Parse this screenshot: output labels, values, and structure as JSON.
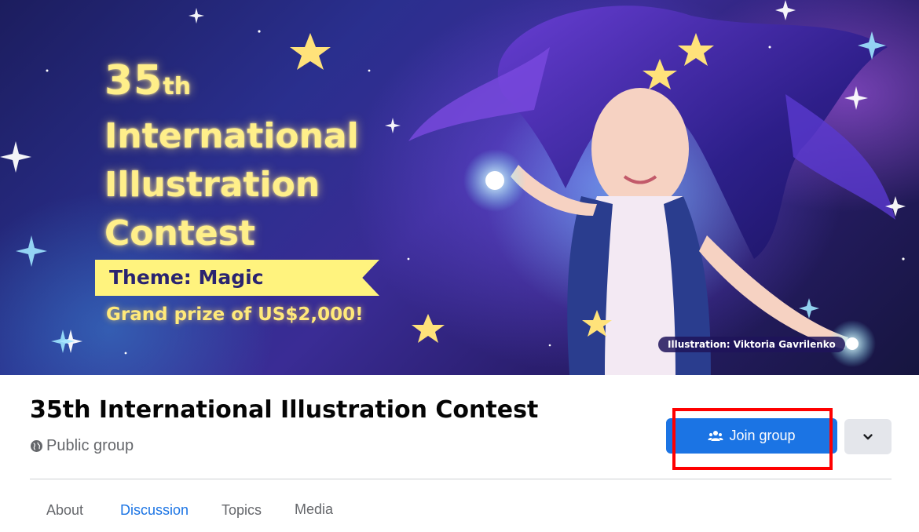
{
  "cover": {
    "title_number": "35",
    "title_suffix": "th",
    "title_line2": "International",
    "title_line3": "Illustration",
    "title_line4": "Contest",
    "theme": "Theme: Magic",
    "prize": "Grand prize of US$2,000!",
    "credit": "Illustration: Viktoria Gavrilenko"
  },
  "group": {
    "name": "35th International Illustration Contest",
    "privacy_label": "Public group",
    "privacy_icon": "globe-icon"
  },
  "actions": {
    "join_label": "Join group",
    "join_icon": "people-icon",
    "more_icon": "chevron-down-icon",
    "accent": "#1b74e4",
    "highlight_color": "#ff0000"
  },
  "tabs": [
    {
      "label": "About",
      "active": false
    },
    {
      "label": "Discussion",
      "active": true
    },
    {
      "label": "Topics",
      "active": false
    },
    {
      "label": "Media",
      "active": false
    }
  ]
}
